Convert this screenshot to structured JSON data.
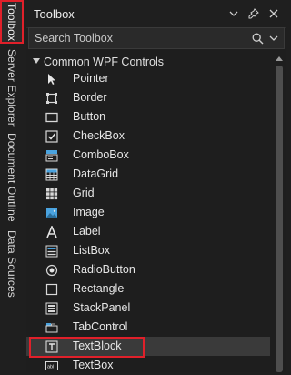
{
  "side_tabs": {
    "toolbox": "Toolbox",
    "server_explorer": "Server Explorer",
    "document_outline": "Document Outline",
    "data_sources": "Data Sources"
  },
  "panel": {
    "title": "Toolbox",
    "search_placeholder": "Search Toolbox"
  },
  "group": {
    "label": "Common WPF Controls",
    "items": [
      {
        "label": "Pointer",
        "icon": "pointer-icon"
      },
      {
        "label": "Border",
        "icon": "border-icon"
      },
      {
        "label": "Button",
        "icon": "button-icon"
      },
      {
        "label": "CheckBox",
        "icon": "checkbox-icon"
      },
      {
        "label": "ComboBox",
        "icon": "combobox-icon"
      },
      {
        "label": "DataGrid",
        "icon": "datagrid-icon"
      },
      {
        "label": "Grid",
        "icon": "grid-icon"
      },
      {
        "label": "Image",
        "icon": "image-icon"
      },
      {
        "label": "Label",
        "icon": "label-icon"
      },
      {
        "label": "ListBox",
        "icon": "listbox-icon"
      },
      {
        "label": "RadioButton",
        "icon": "radiobutton-icon"
      },
      {
        "label": "Rectangle",
        "icon": "rectangle-icon"
      },
      {
        "label": "StackPanel",
        "icon": "stackpanel-icon"
      },
      {
        "label": "TabControl",
        "icon": "tabcontrol-icon"
      },
      {
        "label": "TextBlock",
        "icon": "textblock-icon"
      },
      {
        "label": "TextBox",
        "icon": "textbox-icon"
      }
    ]
  },
  "colors": {
    "highlight": "#e0202a",
    "accent_blue": "#4aa3df",
    "background": "#1e1e1e"
  }
}
